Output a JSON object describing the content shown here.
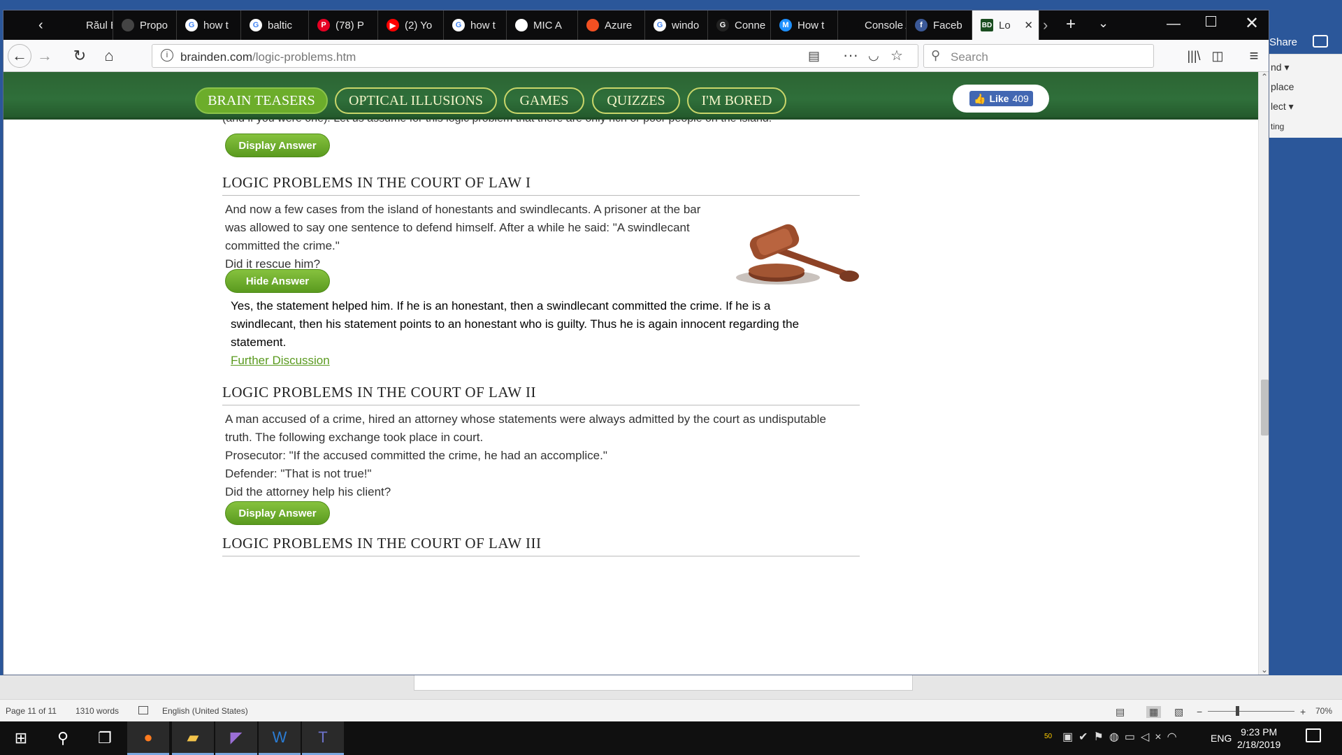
{
  "word": {
    "share_label": "Share",
    "ribbon_items": [
      "nd ▾",
      "place",
      "lect ▾",
      "ting"
    ],
    "status": {
      "page": "Page 11 of 11",
      "words": "1310 words",
      "language": "English (United States)",
      "zoom": "70%"
    }
  },
  "browser": {
    "tabs": [
      {
        "label": "Răul E",
        "fav_color": "#0c0c0d",
        "fav_text": ""
      },
      {
        "label": "Propo",
        "fav_color": "#444",
        "fav_text": ""
      },
      {
        "label": "how t",
        "fav_color": "#ffffff",
        "fav_text": "G"
      },
      {
        "label": "baltic",
        "fav_color": "#ffffff",
        "fav_text": "G"
      },
      {
        "label": "(78) P",
        "fav_color": "#e60023",
        "fav_text": "P"
      },
      {
        "label": "(2) Yo",
        "fav_color": "#ff0000",
        "fav_text": "▶"
      },
      {
        "label": "how t",
        "fav_color": "#ffffff",
        "fav_text": "G"
      },
      {
        "label": "MIC A",
        "fav_color": "#ffffff",
        "fav_text": ""
      },
      {
        "label": "Azure",
        "fav_color": "#f25022",
        "fav_text": ""
      },
      {
        "label": "windo",
        "fav_color": "#ffffff",
        "fav_text": "G"
      },
      {
        "label": "Conne",
        "fav_color": "#222",
        "fav_text": "G"
      },
      {
        "label": "How t",
        "fav_color": "#1e90ff",
        "fav_text": "M"
      },
      {
        "label": "Console A",
        "fav_color": "#0c0c0d",
        "fav_text": ""
      },
      {
        "label": "Faceb",
        "fav_color": "#3b5998",
        "fav_text": "f"
      },
      {
        "label": "Lo",
        "fav_color": "#1a4d20",
        "fav_text": "BD"
      }
    ],
    "url_domain": "brainden.com",
    "url_path": "/logic-problems.htm",
    "search_placeholder": "Search"
  },
  "site": {
    "nav": [
      "BRAIN TEASERS",
      "OPTICAL ILLUSIONS",
      "GAMES",
      "QUIZZES",
      "I'M BORED"
    ],
    "fb_like": {
      "label": "Like",
      "count": "409"
    },
    "cut_text": "(and if you were one). Let us assume for this logic problem that there are only rich or poor people on the island.",
    "btn_display": "Display Answer",
    "btn_hide": "Hide Answer",
    "sections": [
      {
        "title": "LOGIC PROBLEMS IN THE COURT OF LAW I",
        "lines": [
          "And now a few cases from the island of honestants and swindlecants. A prisoner at the bar",
          "was allowed to say one sentence to defend himself. After a while he said: \"A swindlecant",
          "committed the crime.\"",
          "Did it rescue him?"
        ],
        "answer_lines": [
          "Yes, the statement helped him. If he is an honestant, then a swindlecant committed the crime. If he is a",
          "swindlecant, then his statement points to an honestant who is guilty. Thus he is again innocent regarding the",
          "statement."
        ],
        "further": "Further Discussion"
      },
      {
        "title": "LOGIC PROBLEMS IN THE COURT OF LAW II",
        "lines": [
          "A man accused of a crime, hired an attorney whose statements were always admitted by the court as undisputable",
          "truth. The following exchange took place in court.",
          "Prosecutor: \"If the accused committed the crime, he had an accomplice.\"",
          "Defender: \"That is not true!\"",
          "Did the attorney help his client?"
        ]
      },
      {
        "title": "LOGIC PROBLEMS IN THE COURT OF LAW III"
      }
    ]
  },
  "taskbar": {
    "time": "9:23 PM",
    "date": "2/18/2019",
    "lang": "ENG",
    "badge": "50"
  }
}
